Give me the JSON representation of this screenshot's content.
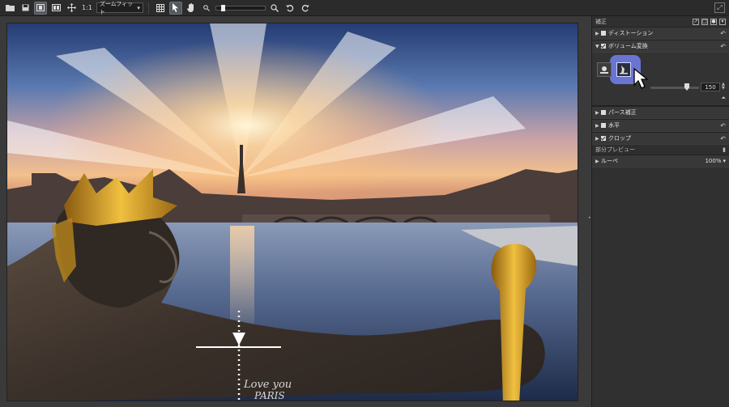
{
  "toolbar": {
    "zoom_1to1": "1:1",
    "zoom_mode": "ズームフィット"
  },
  "panel": {
    "header_title": "補正",
    "sections": {
      "distortion": "ディストーション",
      "volume": "ボリューム変換",
      "perspective": "パース補正",
      "horizontal": "水平",
      "crop": "クロップ"
    },
    "slider_value": "150",
    "subheader_title": "部分プレビュー",
    "loupe_label": "ルーペ",
    "loupe_value": "100%"
  },
  "photo": {
    "inscription_line1": "Love you",
    "inscription_line2": "PARIS"
  },
  "icons": [
    "folder-icon",
    "save-icon",
    "single-view-icon",
    "compare-view-icon",
    "move-icon",
    "grid-icon",
    "select-arrow-icon",
    "hand-icon",
    "zoom-small-icon",
    "zoom-search-icon",
    "rotate-left-icon",
    "rotate-right-icon",
    "expand-icon"
  ]
}
